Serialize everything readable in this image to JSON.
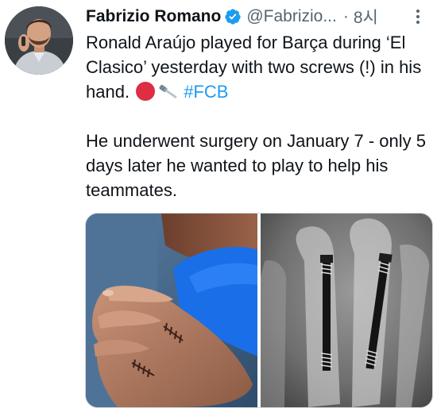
{
  "tweet": {
    "author": {
      "name": "Fabrizio Romano",
      "handle": "@Fabrizio...",
      "verified": true,
      "avatar_icon": "profile-avatar"
    },
    "separator": "·",
    "time": "8시",
    "text": {
      "line1_prefix": "Ronald Araújo played for Barça during ‘El Clasico’ yesterday with two screws (!) in his hand.",
      "emoji1": "red-circle",
      "emoji2": "screwdriver",
      "hashtag": "#FCB",
      "paragraph2": "He underwent surgery on January 7 - only 5 days later he wanted to play to help his teammates."
    },
    "media": [
      {
        "kind": "photo",
        "subject": "hand-with-stitches"
      },
      {
        "kind": "photo",
        "subject": "x-ray-with-two-screws"
      }
    ]
  },
  "colors": {
    "text": "#0f1419",
    "secondary": "#536471",
    "link": "#1d9bf0",
    "verified": "#1d9bf0",
    "red_circle": "#dd2e44"
  }
}
